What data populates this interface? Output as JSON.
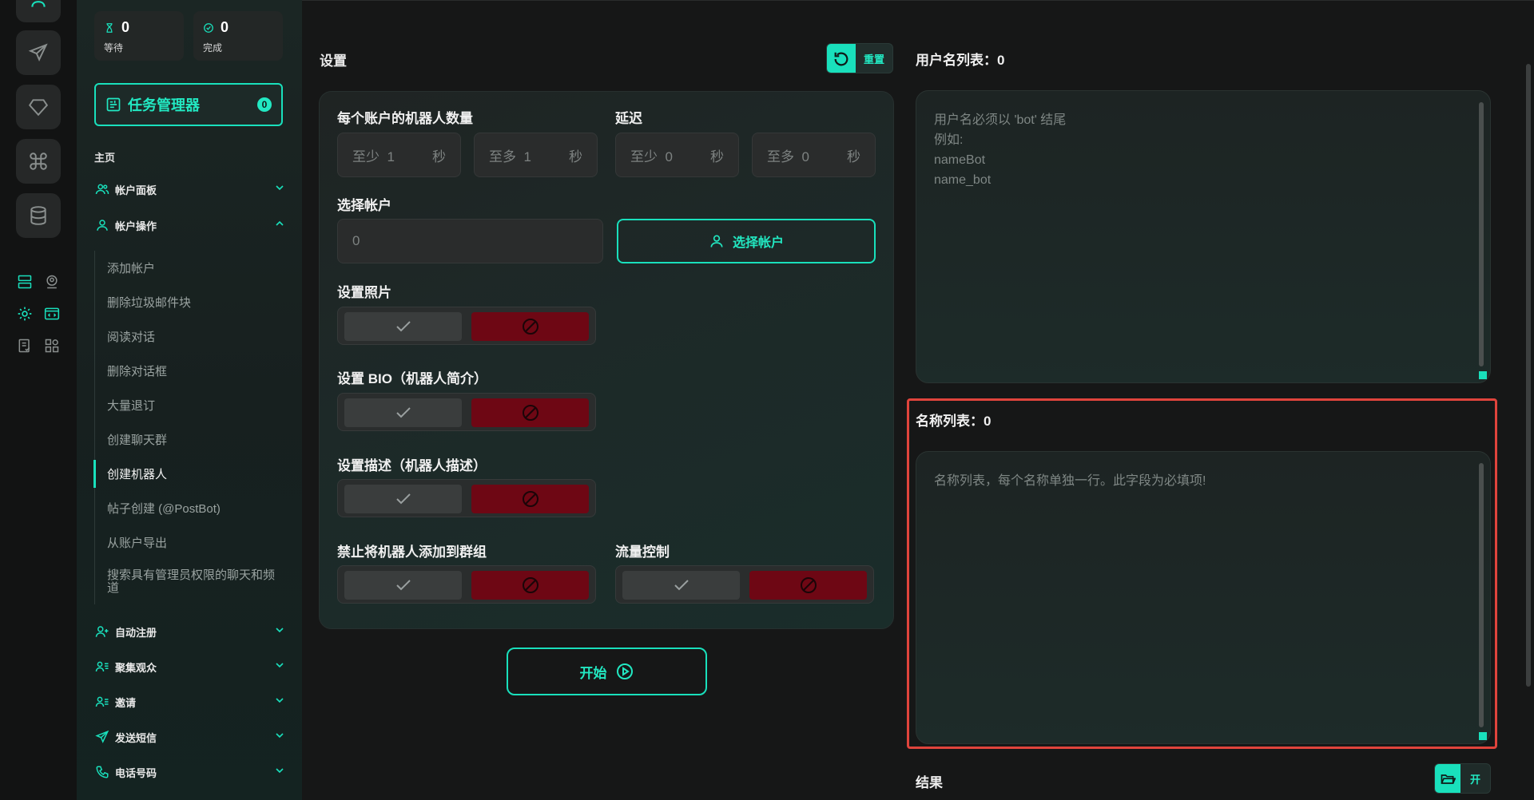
{
  "stats": {
    "waiting": {
      "count": "0",
      "label": "等待",
      "icon": "hourglass-icon"
    },
    "done": {
      "count": "0",
      "label": "完成",
      "icon": "check-circle-icon"
    }
  },
  "task_manager": {
    "label": "任务管理器",
    "badge": "0"
  },
  "sidebar": {
    "section_title": "主页",
    "groups": [
      {
        "label": "帐户面板",
        "icon": "users-icon",
        "expanded": false
      },
      {
        "label": "帐户操作",
        "icon": "user-icon",
        "expanded": true
      },
      {
        "label": "自动注册",
        "icon": "user-plus-icon",
        "expanded": false
      },
      {
        "label": "聚集观众",
        "icon": "users-list-icon",
        "expanded": false
      },
      {
        "label": "邀请",
        "icon": "user-list-icon",
        "expanded": false
      },
      {
        "label": "发送短信",
        "icon": "send-icon",
        "expanded": false
      },
      {
        "label": "电话号码",
        "icon": "phone-icon",
        "expanded": false
      }
    ],
    "sub_items": [
      "添加帐户",
      "删除垃圾邮件块",
      "阅读对话",
      "删除对话框",
      "大量退订",
      "创建聊天群",
      "创建机器人",
      "帖子创建 (@PostBot)",
      "从账户导出",
      "搜索具有管理员权限的聊天和频道"
    ],
    "active_sub_item": "创建机器人"
  },
  "settings": {
    "title": "设置",
    "reset_label": "重置",
    "bots_per_account": {
      "label": "每个账户的机器人数量",
      "min": {
        "prefix": "至少",
        "value": "1",
        "unit": "秒"
      },
      "max": {
        "prefix": "至多",
        "value": "1",
        "unit": "秒"
      }
    },
    "delay": {
      "label": "延迟",
      "min": {
        "prefix": "至少",
        "value": "0",
        "unit": "秒"
      },
      "max": {
        "prefix": "至多",
        "value": "0",
        "unit": "秒"
      }
    },
    "select_account": {
      "label": "选择帐户",
      "value": "0",
      "button_label": "选择帐户"
    },
    "set_photo": {
      "label": "设置照片"
    },
    "set_bio": {
      "label": "设置 BIO（机器人简介）"
    },
    "set_description": {
      "label": "设置描述（机器人描述）"
    },
    "forbid_groups": {
      "label": "禁止将机器人添加到群组"
    },
    "flow_control": {
      "label": "流量控制"
    },
    "start_label": "开始"
  },
  "usernames": {
    "title": "用户名列表：0",
    "placeholder": "用户名必须以 'bot' 结尾\n例如:\nnameBot\nname_bot"
  },
  "names": {
    "title": "名称列表：0",
    "placeholder": "名称列表，每个名称单独一行。此字段为必填项!"
  },
  "results": {
    "title": "结果",
    "open_label": "开"
  },
  "colors": {
    "accent": "#19e0bc",
    "danger": "#6e0714",
    "highlight": "#e0443c"
  }
}
